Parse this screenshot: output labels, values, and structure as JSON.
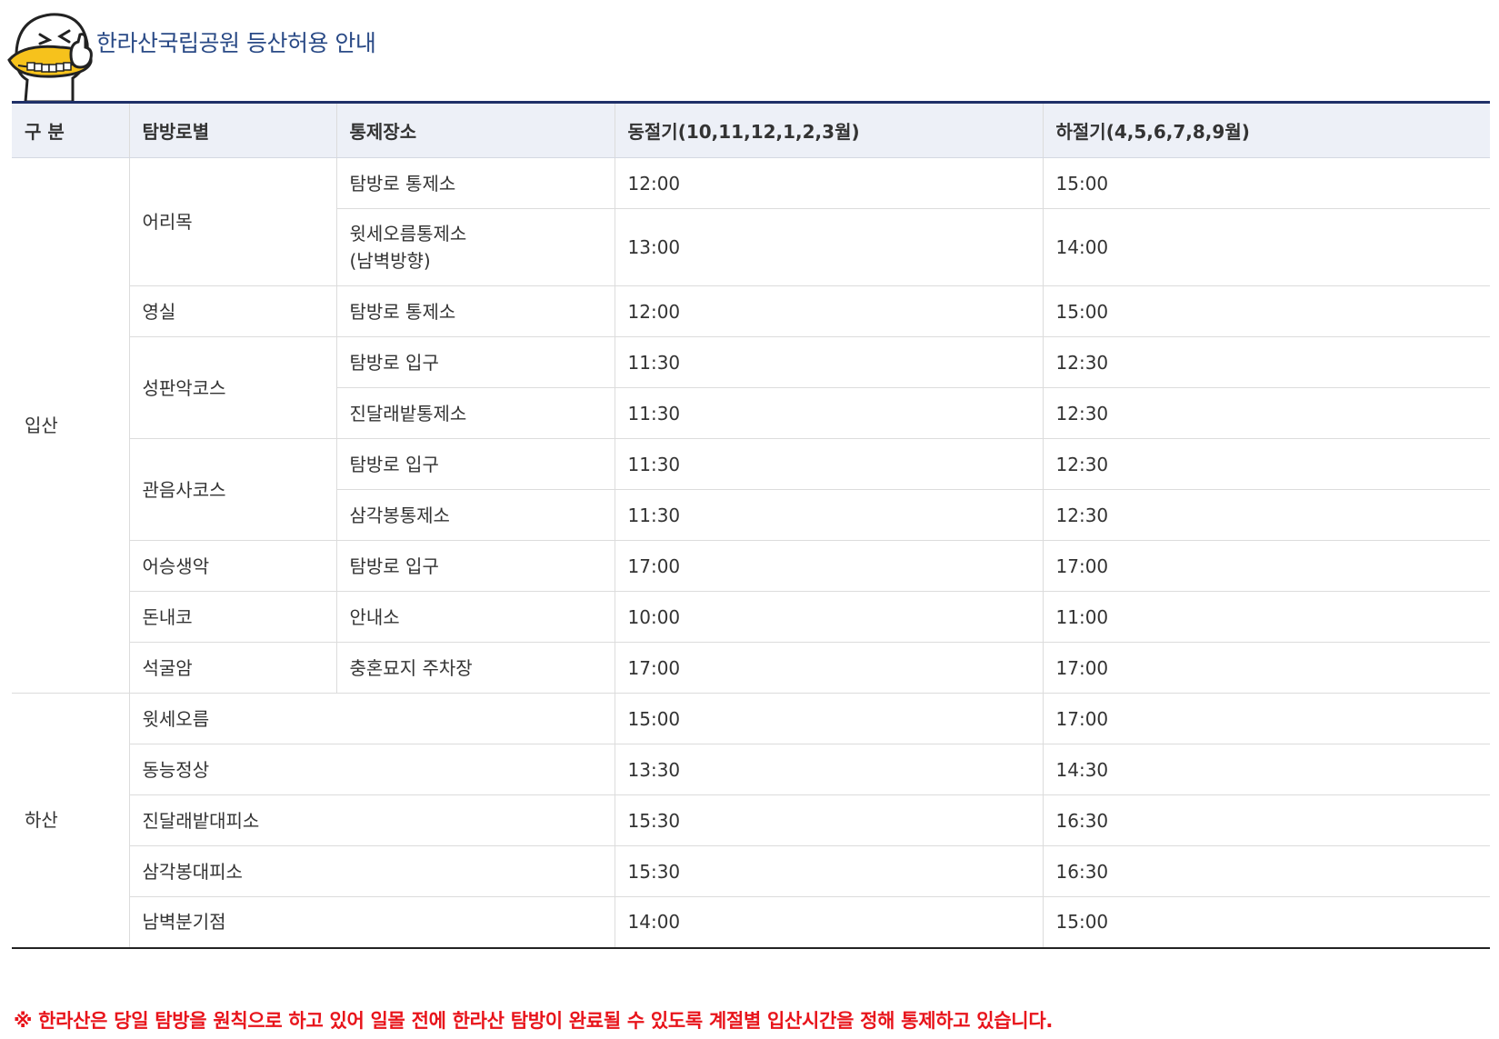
{
  "header": {
    "title": "한라산국립공원 등산허용 안내",
    "mascot_icon": "mascot-duck-icon"
  },
  "table": {
    "columns": [
      "구 분",
      "탐방로별",
      "통제장소",
      "동절기(10,11,12,1,2,3월)",
      "하절기(4,5,6,7,8,9월)"
    ],
    "ascent": {
      "label": "입산",
      "rows": [
        {
          "trail": "어리목",
          "place": "탐방로 통제소",
          "winter": "12:00",
          "summer": "15:00"
        },
        {
          "trail": "",
          "place": "윗세오름통제소\n(남벽방향)",
          "winter": "13:00",
          "summer": "14:00"
        },
        {
          "trail": "영실",
          "place": "탐방로 통제소",
          "winter": "12:00",
          "summer": "15:00"
        },
        {
          "trail": "성판악코스",
          "place": "탐방로 입구",
          "winter": "11:30",
          "summer": "12:30"
        },
        {
          "trail": "",
          "place": "진달래밭통제소",
          "winter": "11:30",
          "summer": "12:30"
        },
        {
          "trail": "관음사코스",
          "place": "탐방로 입구",
          "winter": "11:30",
          "summer": "12:30"
        },
        {
          "trail": "",
          "place": "삼각봉통제소",
          "winter": "11:30",
          "summer": "12:30"
        },
        {
          "trail": "어승생악",
          "place": "탐방로 입구",
          "winter": "17:00",
          "summer": "17:00"
        },
        {
          "trail": "돈내코",
          "place": "안내소",
          "winter": "10:00",
          "summer": "11:00"
        },
        {
          "trail": "석굴암",
          "place": "충혼묘지 주차장",
          "winter": "17:00",
          "summer": "17:00"
        }
      ]
    },
    "descent": {
      "label": "하산",
      "rows": [
        {
          "trail": "윗세오름",
          "winter": "15:00",
          "summer": "17:00"
        },
        {
          "trail": "동능정상",
          "winter": "13:30",
          "summer": "14:30"
        },
        {
          "trail": "진달래밭대피소",
          "winter": "15:30",
          "summer": "16:30"
        },
        {
          "trail": "삼각봉대피소",
          "winter": "15:30",
          "summer": "16:30"
        },
        {
          "trail": "남벽분기점",
          "winter": "14:00",
          "summer": "15:00"
        }
      ]
    }
  },
  "notice": "※ 한라산은 당일 탐방을 원칙으로 하고 있어 일몰 전에 한라산 탐방이 완료될 수 있도록 계절별 입산시간을 정해 통제하고 있습니다.",
  "colors": {
    "title": "#2a4a86",
    "header_bg": "#edf0f7",
    "header_top_border": "#1f3068",
    "notice": "#e8141b",
    "mascot": "#f6c21c"
  }
}
